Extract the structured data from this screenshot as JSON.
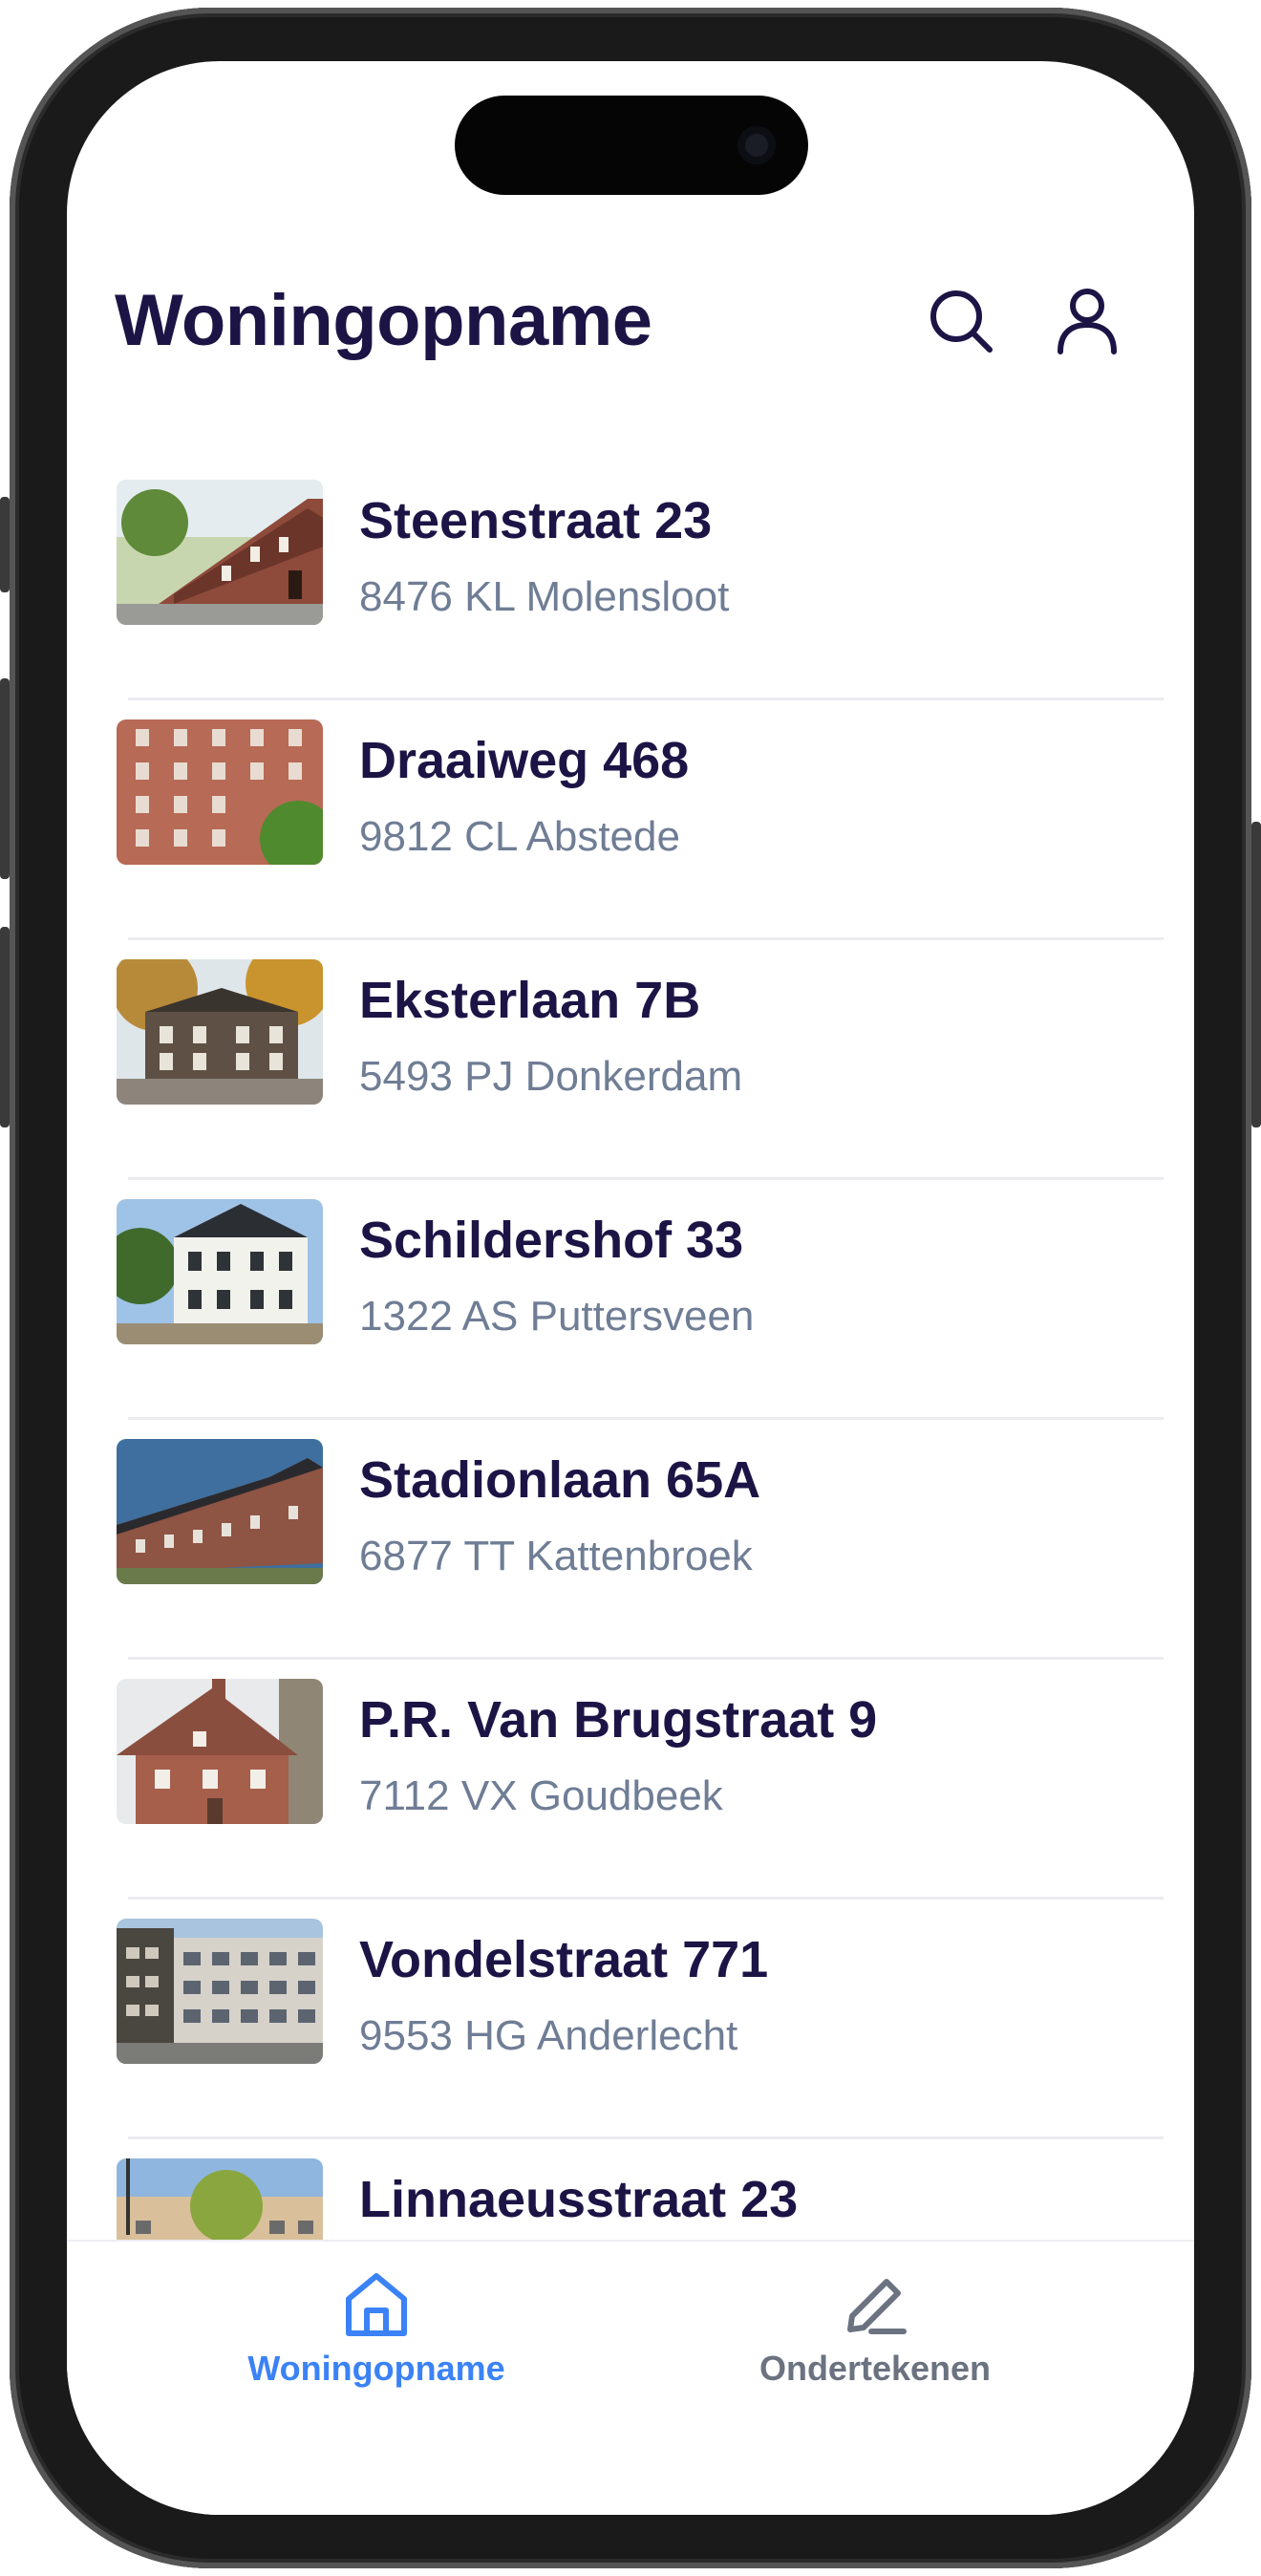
{
  "header": {
    "title": "Woningopname",
    "search_icon": "search-icon",
    "profile_icon": "user-icon"
  },
  "houses": [
    {
      "street": "Steenstraat 23",
      "postal": "8476 KL Molensloot"
    },
    {
      "street": "Draaiweg 468",
      "postal": "9812 CL Abstede"
    },
    {
      "street": "Eksterlaan 7B",
      "postal": "5493 PJ Donkerdam"
    },
    {
      "street": "Schildershof 33",
      "postal": "1322 AS Puttersveen"
    },
    {
      "street": "Stadionlaan 65A",
      "postal": "6877 TT Kattenbroek"
    },
    {
      "street": "P.R. Van Brugstraat 9",
      "postal": "7112 VX Goudbeek"
    },
    {
      "street": "Vondelstraat 771",
      "postal": "9553 HG Anderlecht"
    },
    {
      "street": "Linnaeusstraat 23",
      "postal": ""
    }
  ],
  "tabbar": {
    "tabs": [
      {
        "label": "Woningopname",
        "icon": "home-icon",
        "active": true
      },
      {
        "label": "Ondertekenen",
        "icon": "pen-icon",
        "active": false
      }
    ]
  },
  "colors": {
    "title": "#1d1446",
    "subtitle": "#6f7d95",
    "active_tab": "#3b82f6",
    "inactive_tab": "#6b7280"
  }
}
